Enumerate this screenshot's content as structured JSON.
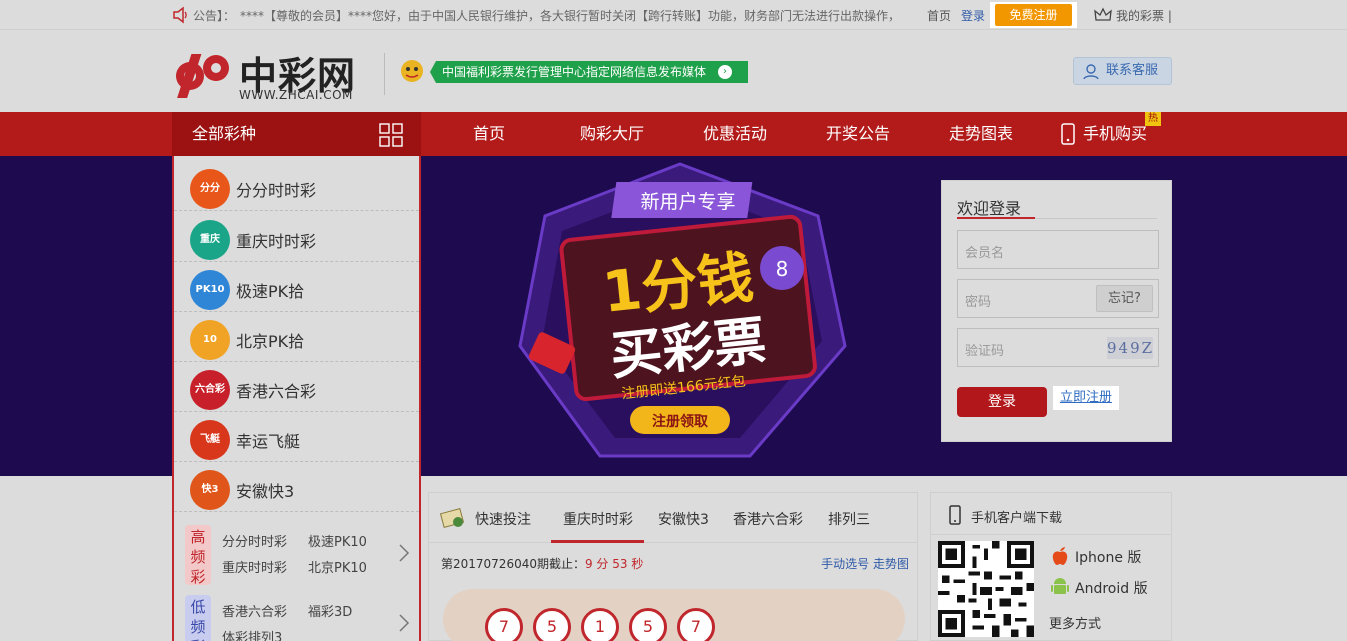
{
  "topbar": {
    "notice_label": "公告】：",
    "notice_text": "****【尊敬的会员】****您好，由于中国人民银行维护，各大银行暂时关闭【跨行转账】功能，财务部门无法进行出款操作，",
    "home": "首页",
    "login": "登录",
    "register": "免费注册",
    "my_lottery": "我的彩票",
    "separator": "|"
  },
  "header": {
    "logo_text": "中彩网",
    "logo_sub": "WWW.ZHCAI.COM",
    "slogan": "中国福利彩票发行管理中心指定网络信息发布媒体",
    "service": "联系客服"
  },
  "nav": {
    "all": "全部彩种",
    "items": [
      "首页",
      "购彩大厅",
      "优惠活动",
      "开奖公告",
      "走势图表",
      "手机购买"
    ],
    "hot": "热"
  },
  "categories": [
    {
      "label": "分分时时彩",
      "icon": "ffssc-icon",
      "badge": "分分",
      "color": "#e8561a"
    },
    {
      "label": "重庆时时彩",
      "icon": "cqssc-icon",
      "badge": "重庆",
      "color": "#1aa588"
    },
    {
      "label": "极速PK拾",
      "icon": "jspk-icon",
      "badge": "PK10",
      "color": "#2f86d6"
    },
    {
      "label": "北京PK拾",
      "icon": "bjpk-icon",
      "badge": "10",
      "color": "#f0a325"
    },
    {
      "label": "香港六合彩",
      "icon": "lhc-icon",
      "badge": "六合彩",
      "color": "#c8202a"
    },
    {
      "label": "幸运飞艇",
      "icon": "xyft-icon",
      "badge": "飞艇",
      "color": "#d8371c"
    },
    {
      "label": "安徽快3",
      "icon": "ahk3-icon",
      "badge": "快3",
      "color": "#e0561a"
    }
  ],
  "groups": [
    {
      "tag": "高频彩",
      "items": [
        "分分时时彩",
        "极速PK10",
        "重庆时时彩",
        "北京PK10"
      ]
    },
    {
      "tag": "低频彩",
      "items": [
        "香港六合彩",
        "福彩3D",
        "体彩排列3"
      ]
    }
  ],
  "banner": {
    "tag": "新用户专享",
    "headline1": "1分钱",
    "headline2": "买彩票",
    "sub": "注册即送166元红包",
    "cta": "注册领取"
  },
  "login": {
    "title": "欢迎登录",
    "username_placeholder": "会员名",
    "password_placeholder": "密码",
    "forget": "忘记?",
    "captcha_placeholder": "验证码",
    "captcha_value": "949Z",
    "submit": "登录",
    "register": "立即注册"
  },
  "bet": {
    "quick": "快速投注",
    "tabs": [
      "重庆时时彩",
      "安徽快3",
      "香港六合彩",
      "排列三"
    ],
    "period_prefix": "第20170726040期截止：",
    "countdown": "9 分 53 秒",
    "manual": "手动选号",
    "trend": "走势图",
    "balls": [
      "7",
      "5",
      "1",
      "5",
      "7"
    ]
  },
  "app": {
    "title": "手机客户端下载",
    "iphone": "Iphone 版",
    "android": "Android 版",
    "more": "更多方式"
  },
  "colors": {
    "brand_red": "#b31b1b",
    "nav_dark": "#9c1212",
    "accent_orange": "#f39700",
    "banner_bg": "#1d0a4f",
    "slogan_green": "#1fa04a"
  }
}
